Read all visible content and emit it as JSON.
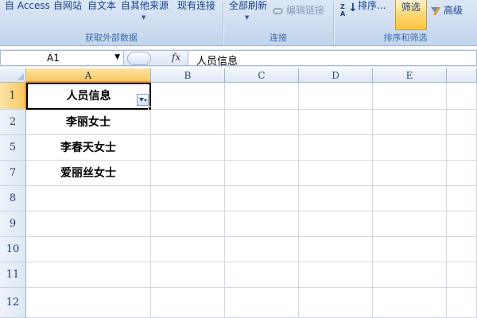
{
  "ribbon": {
    "get_external": {
      "access": "自 Access",
      "web": "自网站",
      "text": "自文本",
      "other": "自其他来源",
      "existing": "现有连接",
      "label": "获取外部数据"
    },
    "connections": {
      "refresh_all": "全部刷新",
      "edit_links": "编辑链接",
      "label": "连接"
    },
    "sort_filter": {
      "sort_az_icon": "sort-az-icon",
      "sort": "排序...",
      "filter": "筛选",
      "advanced": "高级",
      "label": "排序和筛选"
    }
  },
  "formula_bar": {
    "name_box": "A1",
    "fx": "fx",
    "content": "人员信息"
  },
  "columns": [
    "A",
    "B",
    "C",
    "D",
    "E"
  ],
  "rows": [
    {
      "num": "1",
      "a": "人员信息"
    },
    {
      "num": "2",
      "a": "李丽女士"
    },
    {
      "num": "5",
      "a": "李春天女士"
    },
    {
      "num": "7",
      "a": "爱丽丝女士"
    },
    {
      "num": "8",
      "a": ""
    },
    {
      "num": "9",
      "a": ""
    },
    {
      "num": "10",
      "a": ""
    },
    {
      "num": "11",
      "a": ""
    },
    {
      "num": "12",
      "a": ""
    }
  ],
  "colors": {
    "ribbon": "#cfdef1",
    "accent_orange": "#f29536",
    "filter_active": "#ffd97a",
    "grid_line": "#d0d7e5"
  }
}
